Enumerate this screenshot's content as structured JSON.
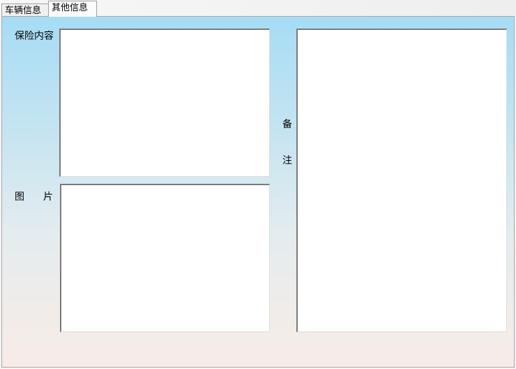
{
  "tabs": [
    {
      "label": "车辆信息"
    },
    {
      "label": "其他信息"
    }
  ],
  "form": {
    "insurance_label": "保险内容",
    "picture_label_left": "图",
    "picture_label_right": "片",
    "remark_label_top": "备",
    "remark_label_bottom": "注",
    "insurance_value": "",
    "picture_value": "",
    "remark_value": ""
  }
}
